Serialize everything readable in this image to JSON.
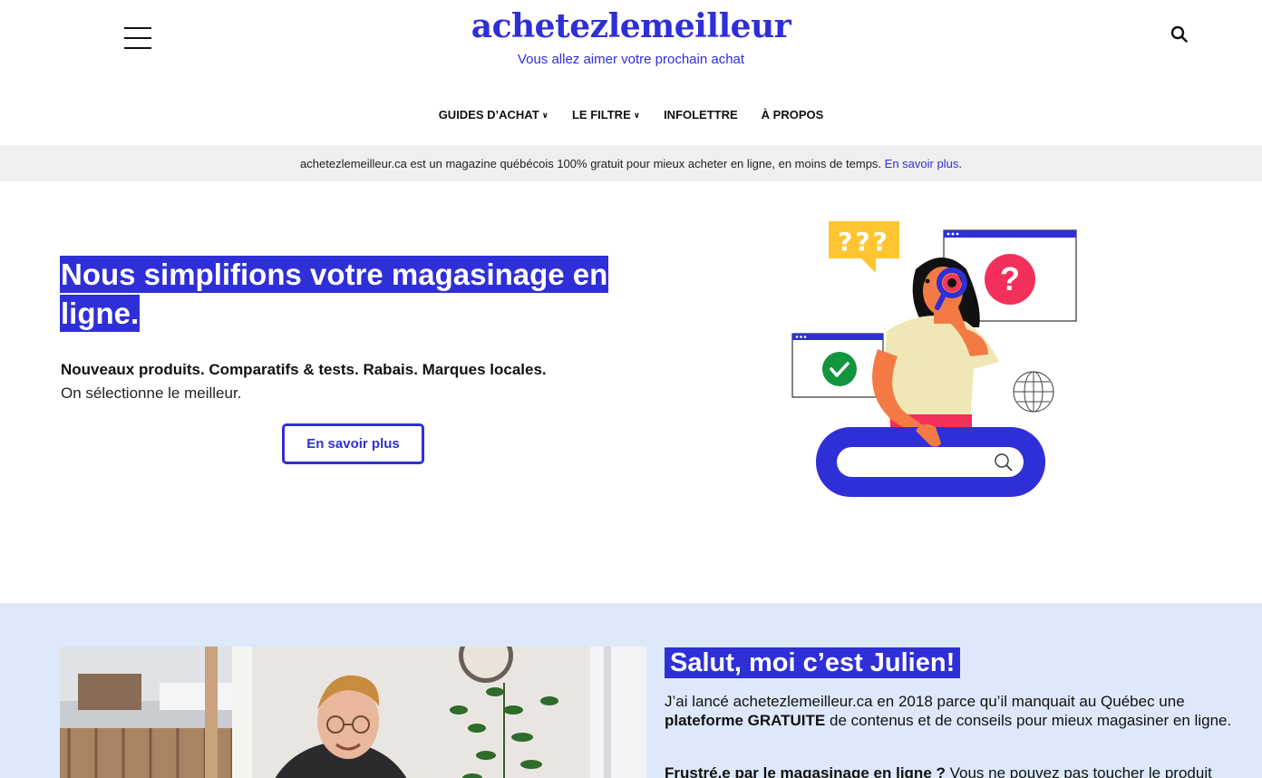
{
  "header": {
    "logo_title": "achetezlemeilleur",
    "tagline": "Vous allez aimer votre prochain achat",
    "menu_icon": "hamburger-icon",
    "search_icon": "search-icon"
  },
  "nav": {
    "items": [
      {
        "label": "GUIDES D’ACHAT",
        "has_dropdown": true
      },
      {
        "label": "LE FILTRE",
        "has_dropdown": true
      },
      {
        "label": "INFOLETTRE",
        "has_dropdown": false
      },
      {
        "label": "À PROPOS",
        "has_dropdown": false
      }
    ]
  },
  "banner": {
    "text": "achetezlemeilleur.ca est un magazine québécois 100% gratuit pour mieux acheter en ligne, en moins de temps.",
    "link_label": "En savoir plus",
    "suffix": "."
  },
  "hero": {
    "title": "Nous simplifions votre magasinage en ligne.",
    "bold_line": "Nouveaux produits. Comparatifs & tests. Rabais. Marques locales.",
    "sub_line": "On sélectionne le meilleur.",
    "button_label": "En savoir plus",
    "illustration": {
      "bubble_text": "???",
      "alert_symbol": "?"
    }
  },
  "about": {
    "heading": "Salut, moi c’est Julien!",
    "p1_a": "J’ai lancé achetezlemeilleur.ca en 2018 parce qu’il manquait au Québec une ",
    "p1_bold": "plateforme GRATUITE",
    "p1_b": " de contenus et de conseils pour mieux magasiner en ligne.",
    "p2_bold": "Frustré.e par le magasinage en ligne ?",
    "p2_rest": " Vous ne pouvez pas toucher le produit"
  },
  "colors": {
    "accent": "#2f2fd8",
    "banner_bg": "#efefef",
    "about_bg": "#dde9fb"
  }
}
